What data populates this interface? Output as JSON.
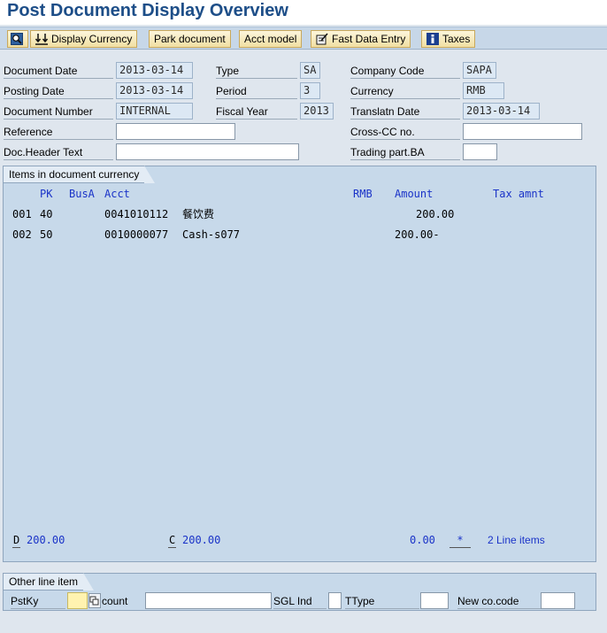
{
  "title": "Post Document Display Overview",
  "toolbar": {
    "display_currency": "Display Currency",
    "park_document": "Park document",
    "acct_model": "Acct model",
    "fast_data_entry": "Fast Data Entry",
    "taxes": "Taxes"
  },
  "header": {
    "document_date": {
      "label": "Document Date",
      "value": "2013-03-14"
    },
    "posting_date": {
      "label": "Posting Date",
      "value": "2013-03-14"
    },
    "document_number": {
      "label": "Document Number",
      "value": "INTERNAL"
    },
    "reference": {
      "label": "Reference",
      "value": ""
    },
    "doc_header_text": {
      "label": "Doc.Header Text",
      "value": ""
    },
    "type": {
      "label": "Type",
      "value": "SA"
    },
    "period": {
      "label": "Period",
      "value": "3"
    },
    "fiscal_year": {
      "label": "Fiscal Year",
      "value": "2013"
    },
    "company_code": {
      "label": "Company Code",
      "value": "SAPA"
    },
    "currency": {
      "label": "Currency",
      "value": "RMB"
    },
    "translatn_date": {
      "label": "Translatn Date",
      "value": "2013-03-14"
    },
    "cross_cc": {
      "label": "Cross-CC no.",
      "value": ""
    },
    "trading_part": {
      "label": "Trading part.BA",
      "value": ""
    }
  },
  "items": {
    "title": "Items in document currency",
    "columns": {
      "pk": "PK",
      "busa": "BusA",
      "acct": "Acct",
      "currency": "RMB",
      "amount": "Amount",
      "tax": "Tax amnt"
    },
    "rows": [
      {
        "no": "001",
        "pk": "40",
        "acct": "0041010112",
        "name": "餐饮费",
        "amount": "200.00"
      },
      {
        "no": "002",
        "pk": "50",
        "acct": "0010000077",
        "name": "Cash-s077",
        "amount": "200.00-"
      }
    ],
    "totals": {
      "d_label": "D",
      "d_value": "200.00",
      "c_label": "C",
      "c_value": "200.00",
      "balance": "0.00",
      "flag": "*",
      "line_items": "2 Line items"
    }
  },
  "other": {
    "title": "Other line item",
    "pstky_label": "PstKy",
    "pstky_value": "",
    "account_label": "count",
    "account_value": "",
    "sgl_label": "SGL Ind",
    "sgl_value": "",
    "ttype_label": "TType",
    "ttype_value": "",
    "newcc_label": "New co.code",
    "newcc_value": ""
  }
}
